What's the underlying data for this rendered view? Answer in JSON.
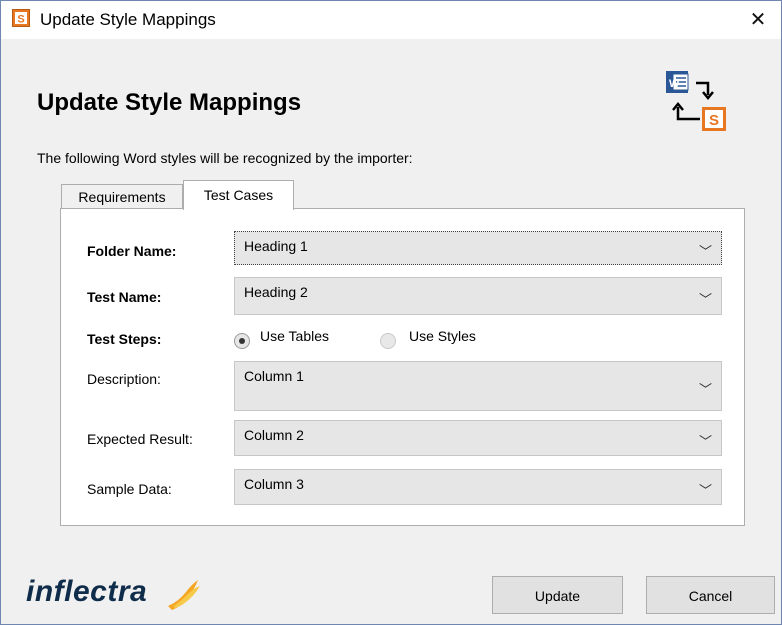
{
  "window": {
    "title": "Update Style Mappings",
    "close_glyph": "✕"
  },
  "header": {
    "heading": "Update Style Mappings",
    "intro": "The following Word styles will be recognized by the importer:"
  },
  "tabs": [
    {
      "label": "Requirements",
      "active": false
    },
    {
      "label": "Test Cases",
      "active": true
    }
  ],
  "form": {
    "folder_name": {
      "label": "Folder Name:",
      "value": "Heading 1"
    },
    "test_name": {
      "label": "Test Name:",
      "value": "Heading 2"
    },
    "test_steps": {
      "label": "Test Steps:",
      "options": [
        {
          "label": "Use Tables",
          "checked": true
        },
        {
          "label": "Use Styles",
          "checked": false
        }
      ]
    },
    "description": {
      "label": "Description:",
      "value": "Column 1"
    },
    "expected_result": {
      "label": "Expected Result:",
      "value": "Column 2"
    },
    "sample_data": {
      "label": "Sample Data:",
      "value": "Column 3"
    }
  },
  "footer": {
    "brand": "inflectra",
    "update_label": "Update",
    "cancel_label": "Cancel"
  },
  "icons": {
    "app": "spiraplan-s-icon",
    "header_graphic": "word-to-spira-sync-icon",
    "chevron": "chevron-down-icon"
  },
  "colors": {
    "accent_orange": "#e87722",
    "word_blue": "#2b5797",
    "brand_navy": "#0f2d4a"
  }
}
